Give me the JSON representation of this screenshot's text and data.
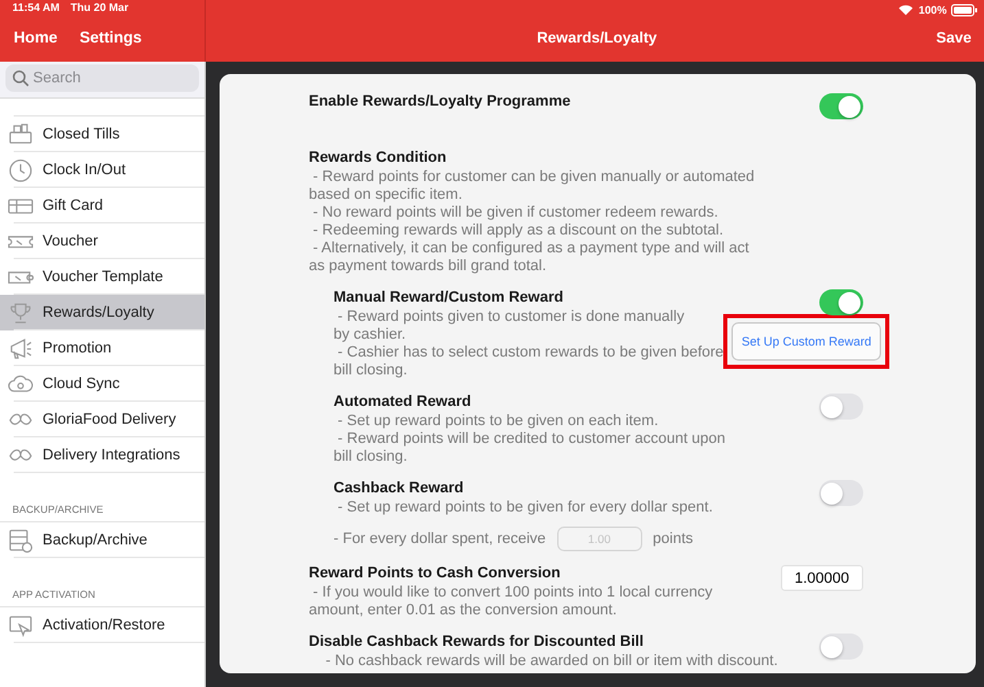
{
  "status_bar": {
    "time": "11:54 AM",
    "date": "Thu 20 Mar",
    "battery": "100%"
  },
  "nav": {
    "links": [
      "Home",
      "Settings"
    ],
    "title": "Rewards/Loyalty",
    "action": "Save"
  },
  "sidebar": {
    "search": {
      "placeholder": "Search"
    },
    "groups": [
      {
        "items": [
          {
            "label": "Closed Tills",
            "selected": false
          },
          {
            "label": "Clock In/Out",
            "selected": false
          },
          {
            "label": "Gift Card",
            "selected": false
          },
          {
            "label": "Voucher",
            "selected": false
          },
          {
            "label": "Voucher Template",
            "selected": false
          },
          {
            "label": "Rewards/Loyalty",
            "selected": true
          },
          {
            "label": "Promotion",
            "selected": false
          },
          {
            "label": "Cloud Sync",
            "selected": false
          },
          {
            "label": "GloriaFood Delivery",
            "selected": false
          },
          {
            "label": "Delivery Integrations",
            "selected": false
          }
        ]
      },
      {
        "header": "BACKUP/ARCHIVE",
        "items": [
          {
            "label": "Backup/Archive",
            "selected": false
          }
        ]
      },
      {
        "header": "APP ACTIVATION",
        "items": [
          {
            "label": "Activation/Restore",
            "selected": false
          }
        ]
      }
    ]
  },
  "settings": [
    {
      "kind": "toggle",
      "title": "Enable Rewards/Loyalty Programme",
      "on": true
    },
    {
      "kind": "info",
      "title": "Rewards Condition",
      "lines": [
        " - Reward points for customer can be given manually or automated\nbased on specific item.",
        " - No reward points will be given if customer redeem rewards.",
        " - Redeeming rewards will apply as a discount on the subtotal.",
        " - Alternatively, it can be configured as a payment type and will act\nas payment towards bill grand total."
      ],
      "children": [
        {
          "kind": "toggle",
          "title": "Manual Reward/Custom Reward",
          "on": true,
          "lines": [
            " - Reward points given to customer is done manually\nby cashier.",
            " - Cashier has to select custom rewards to be given before\nbill closing."
          ],
          "button": "Set Up Custom Reward"
        },
        {
          "kind": "toggle",
          "title": "Automated Reward",
          "on": false,
          "lines": [
            " - Set up reward points to be given on each item.",
            " - Reward points will be credited to customer account upon\nbill closing."
          ]
        },
        {
          "kind": "toggle",
          "title": "Cashback Reward",
          "on": false,
          "lines": [
            " - Set up reward points to be given for every dollar spent."
          ],
          "rate": {
            "prefix": " - For every dollar spent, receive",
            "placeholder": "1.00",
            "suffix": "points"
          }
        }
      ]
    },
    {
      "kind": "number",
      "title": "Reward Points to Cash Conversion",
      "value": "1.00000",
      "lines": [
        " - If you would like to convert 100 points into 1 local currency\namount, enter 0.01 as the conversion amount."
      ]
    },
    {
      "kind": "toggle",
      "title": "Disable Cashback Rewards for Discounted Bill",
      "on": false,
      "lines": [
        "    - No cashback rewards will be awarded on bill or item with discount."
      ]
    }
  ]
}
